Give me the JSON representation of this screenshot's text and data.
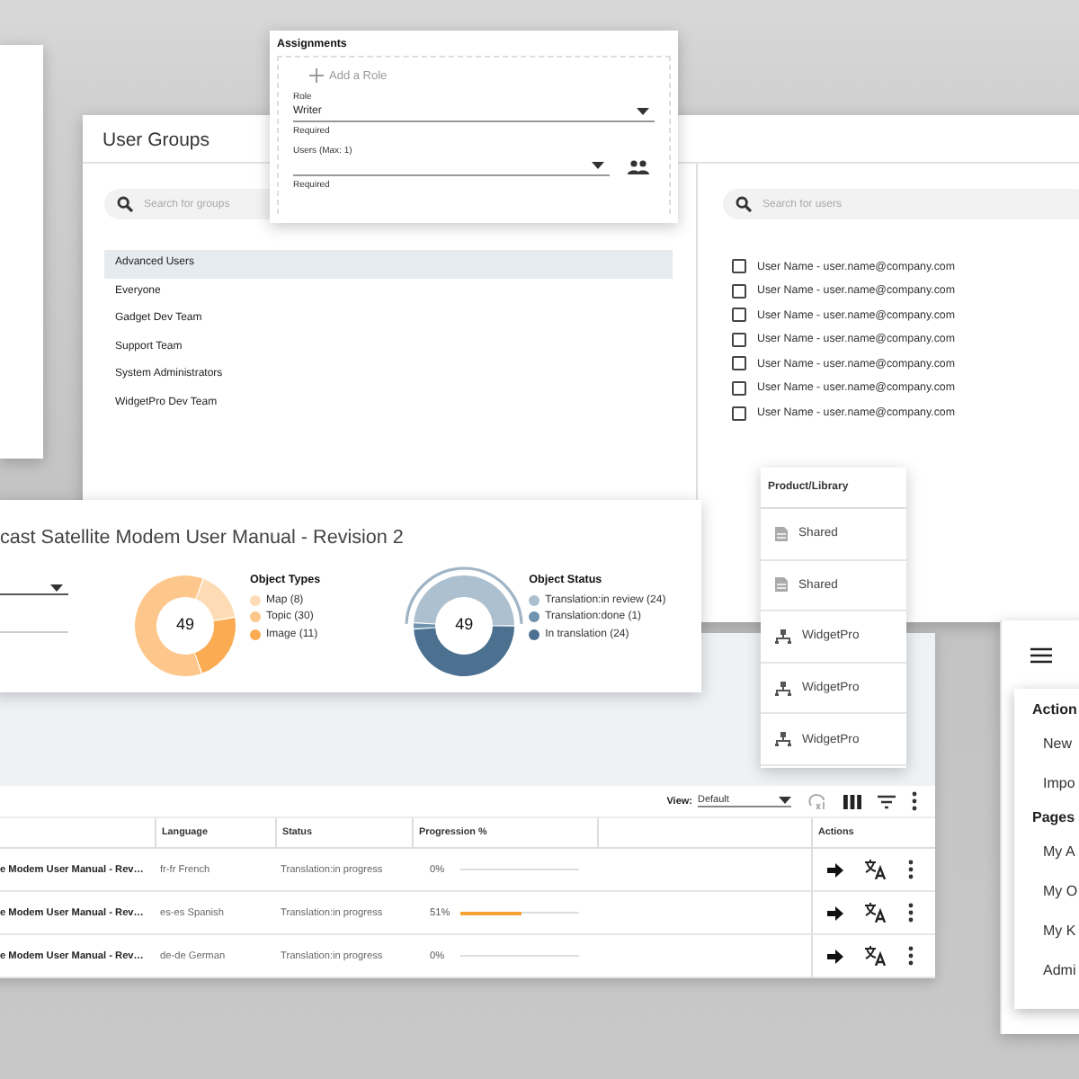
{
  "assignments": {
    "title": "Assignments",
    "add_role": "Add a Role",
    "fields": [
      {
        "label": "Role",
        "value": "Writer",
        "helper": "Required",
        "kind": "select"
      },
      {
        "label": "Users (Max: 1)",
        "helper": "Required",
        "kind": "user-select"
      }
    ]
  },
  "user_groups": {
    "title": "User Groups",
    "group_search": {
      "placeholder": "Search for groups"
    },
    "groups": [
      {
        "label": "Advanced Users",
        "selected": true
      },
      {
        "label": "Everyone",
        "selected": false
      },
      {
        "label": "Gadget Dev Team",
        "selected": false
      },
      {
        "label": "Support Team",
        "selected": false
      },
      {
        "label": "System Administrators",
        "selected": false
      },
      {
        "label": "WidgetPro Dev Team",
        "selected": false
      }
    ],
    "user_search": {
      "placeholder": "Search for users"
    },
    "users": [
      {
        "label": "User Name - user.name@company.com",
        "checked": false
      },
      {
        "label": "User Name - user.name@company.com",
        "checked": false
      },
      {
        "label": "User Name - user.name@company.com",
        "checked": false
      },
      {
        "label": "User Name - user.name@company.com",
        "checked": false
      },
      {
        "label": "User Name - user.name@company.com",
        "checked": false
      },
      {
        "label": "User Name - user.name@company.com",
        "checked": false
      },
      {
        "label": "User Name - user.name@company.com",
        "checked": false
      }
    ]
  },
  "revision_panel": {
    "title": "cast Satellite Modem User Manual - Revision 2",
    "charts": [
      {
        "total": "49",
        "highlight": false,
        "legend": [
          {
            "color": "#fddcb5"
          },
          {
            "color": "#fdc68a"
          },
          {
            "color": "#fbab52"
          }
        ],
        "chart_data": {
          "type": "donut",
          "title": "Object Types",
          "categories": [
            "Map (8)",
            "Topic (30)",
            "Image (11)"
          ],
          "values": [
            8,
            30,
            11
          ]
        }
      },
      {
        "total": "49",
        "highlight": true,
        "legend": [
          {
            "color": "#adc0cf"
          },
          {
            "color": "#6f92ae"
          },
          {
            "color": "#4b7090"
          }
        ],
        "chart_data": {
          "type": "donut",
          "title": "Object Status",
          "categories": [
            "Translation:in review (24)",
            "Translation:done (1)",
            "In translation (24)"
          ],
          "values": [
            24,
            1,
            24
          ]
        }
      }
    ]
  },
  "translations_table": {
    "view_label": "View:",
    "view_value": "Default",
    "columns": [
      "Language",
      "Status",
      "Progression %",
      "Actions"
    ],
    "rows": [
      {
        "document": "e Modem User Manual - Rev…",
        "language": "fr-fr French",
        "status": "Translation:in progress",
        "reading": "0%",
        "level": 0
      },
      {
        "document": "e Modem User Manual - Rev…",
        "language": "es-es Spanish",
        "status": "Translation:in progress",
        "reading": "51%",
        "level": 0.51
      },
      {
        "document": "e Modem User Manual - Rev…",
        "language": "de-de German",
        "status": "Translation:in progress",
        "reading": "0%",
        "level": 0
      }
    ]
  },
  "product_library": {
    "title": "Product/Library",
    "items": [
      {
        "label": "Shared",
        "kind": "shared"
      },
      {
        "label": "Shared",
        "kind": "shared"
      },
      {
        "label": "WidgetPro",
        "kind": "product"
      },
      {
        "label": "WidgetPro",
        "kind": "product"
      },
      {
        "label": "WidgetPro",
        "kind": "product"
      }
    ]
  },
  "nav_menu": {
    "sections": [
      {
        "heading": "Action",
        "items": [
          "New",
          "Impo"
        ]
      },
      {
        "heading": "Pages",
        "items": [
          "My A",
          "My O",
          "My K",
          "Admi"
        ]
      }
    ]
  }
}
